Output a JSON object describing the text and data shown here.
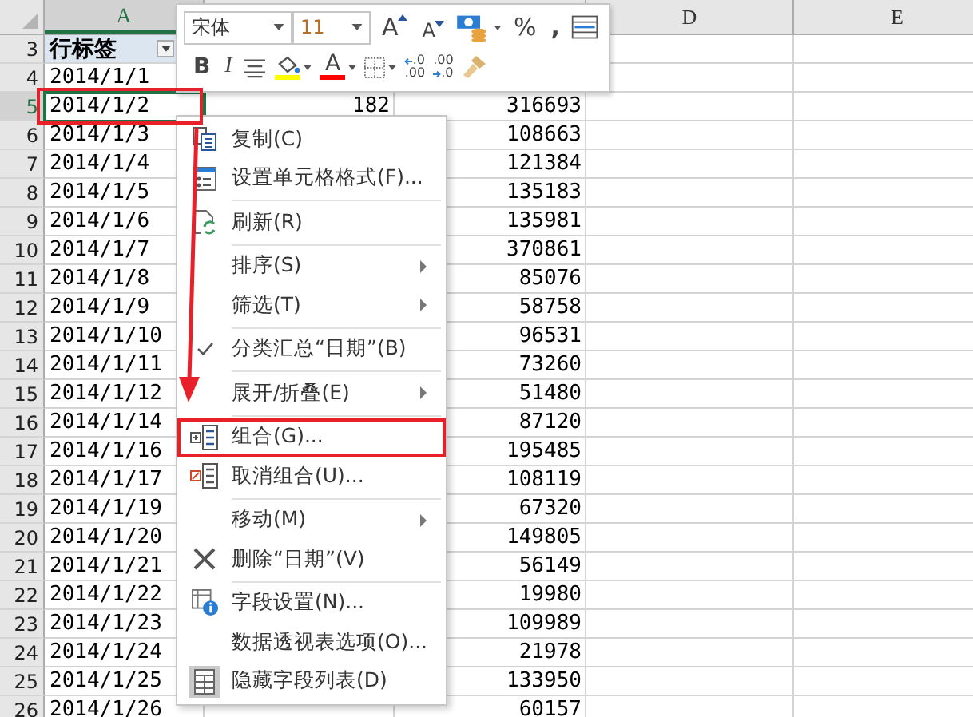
{
  "toolbar": {
    "font": "宋体",
    "font_size": "11",
    "grow_font": "A",
    "shrink_font": "A",
    "percent": "%",
    "comma": ",",
    "bold": "B",
    "italic": "I",
    "font_color_letter": "A",
    "add_decimal": [
      ".0",
      ".00"
    ],
    "remove_decimal": [
      ".00",
      ".0"
    ]
  },
  "columns": [
    {
      "label": "A",
      "selected": true
    },
    {
      "label": "D",
      "selected": false
    },
    {
      "label": "E",
      "selected": false
    }
  ],
  "rows": [
    {
      "row": "3",
      "kind": "heading",
      "date": "行标签",
      "selected": false
    },
    {
      "row": "4",
      "kind": "data",
      "date": "2014/1/1",
      "selected": false
    },
    {
      "row": "5",
      "kind": "data",
      "date": "2014/1/2",
      "count": "182",
      "value": "316693",
      "selected": true
    },
    {
      "row": "6",
      "kind": "data",
      "date": "2014/1/3",
      "value": "108663",
      "selected": false
    },
    {
      "row": "7",
      "kind": "data",
      "date": "2014/1/4",
      "value": "121384",
      "selected": false
    },
    {
      "row": "8",
      "kind": "data",
      "date": "2014/1/5",
      "value": "135183",
      "selected": false
    },
    {
      "row": "9",
      "kind": "data",
      "date": "2014/1/6",
      "value": "135981",
      "selected": false
    },
    {
      "row": "10",
      "kind": "data",
      "date": "2014/1/7",
      "value": "370861",
      "selected": false
    },
    {
      "row": "11",
      "kind": "data",
      "date": "2014/1/8",
      "value": "85076",
      "selected": false
    },
    {
      "row": "12",
      "kind": "data",
      "date": "2014/1/9",
      "value": "58758",
      "selected": false
    },
    {
      "row": "13",
      "kind": "data",
      "date": "2014/1/10",
      "value": "96531",
      "selected": false
    },
    {
      "row": "14",
      "kind": "data",
      "date": "2014/1/11",
      "value": "73260",
      "selected": false
    },
    {
      "row": "15",
      "kind": "data",
      "date": "2014/1/12",
      "value": "51480",
      "selected": false
    },
    {
      "row": "16",
      "kind": "data",
      "date": "2014/1/14",
      "value": "87120",
      "selected": false
    },
    {
      "row": "17",
      "kind": "data",
      "date": "2014/1/16",
      "value": "195485",
      "selected": false
    },
    {
      "row": "18",
      "kind": "data",
      "date": "2014/1/17",
      "value": "108119",
      "selected": false
    },
    {
      "row": "19",
      "kind": "data",
      "date": "2014/1/19",
      "value": "67320",
      "selected": false
    },
    {
      "row": "20",
      "kind": "data",
      "date": "2014/1/20",
      "value": "149805",
      "selected": false
    },
    {
      "row": "21",
      "kind": "data",
      "date": "2014/1/21",
      "value": "56149",
      "selected": false
    },
    {
      "row": "22",
      "kind": "data",
      "date": "2014/1/22",
      "value": "19980",
      "selected": false
    },
    {
      "row": "23",
      "kind": "data",
      "date": "2014/1/23",
      "value": "109989",
      "selected": false
    },
    {
      "row": "24",
      "kind": "data",
      "date": "2014/1/24",
      "value": "21978",
      "selected": false
    },
    {
      "row": "25",
      "kind": "data",
      "date": "2014/1/25",
      "value": "133950",
      "selected": false
    },
    {
      "row": "26",
      "kind": "data",
      "date": "2014/1/26",
      "value": "60157",
      "selected": false
    }
  ],
  "context_menu": {
    "items": [
      {
        "kind": "item",
        "label": "复制(C)",
        "checked": false,
        "submenu": false,
        "highlighted": false
      },
      {
        "kind": "item",
        "label": "设置单元格格式(F)...",
        "checked": false,
        "submenu": false,
        "highlighted": false
      },
      {
        "kind": "separator"
      },
      {
        "kind": "item",
        "label": "刷新(R)",
        "checked": false,
        "submenu": false,
        "highlighted": false
      },
      {
        "kind": "separator"
      },
      {
        "kind": "item",
        "label": "排序(S)",
        "checked": false,
        "submenu": true,
        "highlighted": false
      },
      {
        "kind": "item",
        "label": "筛选(T)",
        "checked": false,
        "submenu": true,
        "highlighted": false
      },
      {
        "kind": "separator"
      },
      {
        "kind": "item",
        "label": "分类汇总“日期”(B)",
        "checked": true,
        "submenu": false,
        "highlighted": false
      },
      {
        "kind": "separator"
      },
      {
        "kind": "item",
        "label": "展开/折叠(E)",
        "checked": false,
        "submenu": true,
        "highlighted": false
      },
      {
        "kind": "separator"
      },
      {
        "kind": "item",
        "label": "组合(G)...",
        "checked": false,
        "submenu": false,
        "highlighted": true
      },
      {
        "kind": "item",
        "label": "取消组合(U)...",
        "checked": false,
        "submenu": false,
        "highlighted": false
      },
      {
        "kind": "separator"
      },
      {
        "kind": "item",
        "label": "移动(M)",
        "checked": false,
        "submenu": true,
        "highlighted": false
      },
      {
        "kind": "item",
        "label": "删除“日期”(V)",
        "checked": false,
        "submenu": false,
        "highlighted": false
      },
      {
        "kind": "separator"
      },
      {
        "kind": "item",
        "label": "字段设置(N)...",
        "checked": false,
        "submenu": false,
        "highlighted": false
      },
      {
        "kind": "item",
        "label": "数据透视表选项(O)...",
        "checked": false,
        "submenu": false,
        "highlighted": false
      },
      {
        "kind": "item",
        "label": "隐藏字段列表(D)",
        "checked": false,
        "submenu": false,
        "highlighted": false
      }
    ]
  }
}
